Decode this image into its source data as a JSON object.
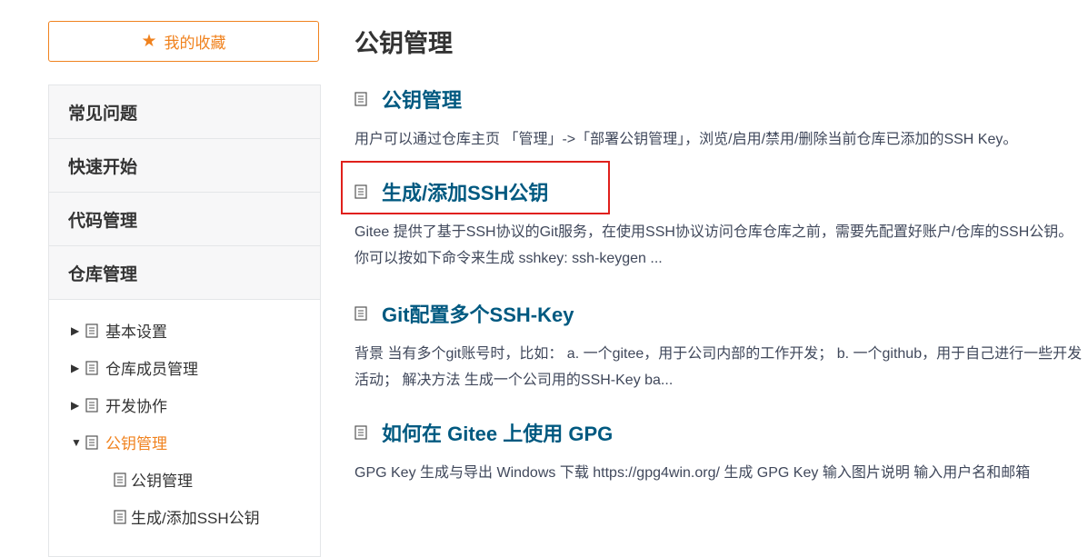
{
  "sidebar": {
    "favorites_label": "我的收藏",
    "categories": [
      "常见问题",
      "快速开始",
      "代码管理",
      "仓库管理"
    ],
    "tree": [
      {
        "label": "基本设置",
        "expanded": false
      },
      {
        "label": "仓库成员管理",
        "expanded": false
      },
      {
        "label": "开发协作",
        "expanded": false
      },
      {
        "label": "公钥管理",
        "expanded": true,
        "active": true
      }
    ],
    "subitems": [
      "公钥管理",
      "生成/添加SSH公钥"
    ]
  },
  "main": {
    "page_title": "公钥管理",
    "results": [
      {
        "title": "公钥管理",
        "desc": "用户可以通过仓库主页 「管理」->「部署公钥管理」，浏览/启用/禁用/删除当前仓库已添加的SSH Key。"
      },
      {
        "title": "生成/添加SSH公钥",
        "desc": "Gitee 提供了基于SSH协议的Git服务，在使用SSH协议访问仓库仓库之前，需要先配置好账户/仓库的SSH公钥。 你可以按如下命令来生成 sshkey: ssh-keygen ..."
      },
      {
        "title": "Git配置多个SSH-Key",
        "desc": "背景 当有多个git账号时，比如： a. 一个gitee，用于公司内部的工作开发； b. 一个github，用于自己进行一些开发活动； 解决方法 生成一个公司用的SSH-Key ba..."
      },
      {
        "title": "如何在 Gitee 上使用 GPG",
        "desc": "GPG Key 生成与导出 Windows 下载 https://gpg4win.org/ 生成 GPG Key 输入图片说明 输入用户名和邮箱"
      }
    ]
  },
  "colors": {
    "accent": "#f0821e",
    "link": "#005980",
    "highlight": "#e0201c"
  }
}
